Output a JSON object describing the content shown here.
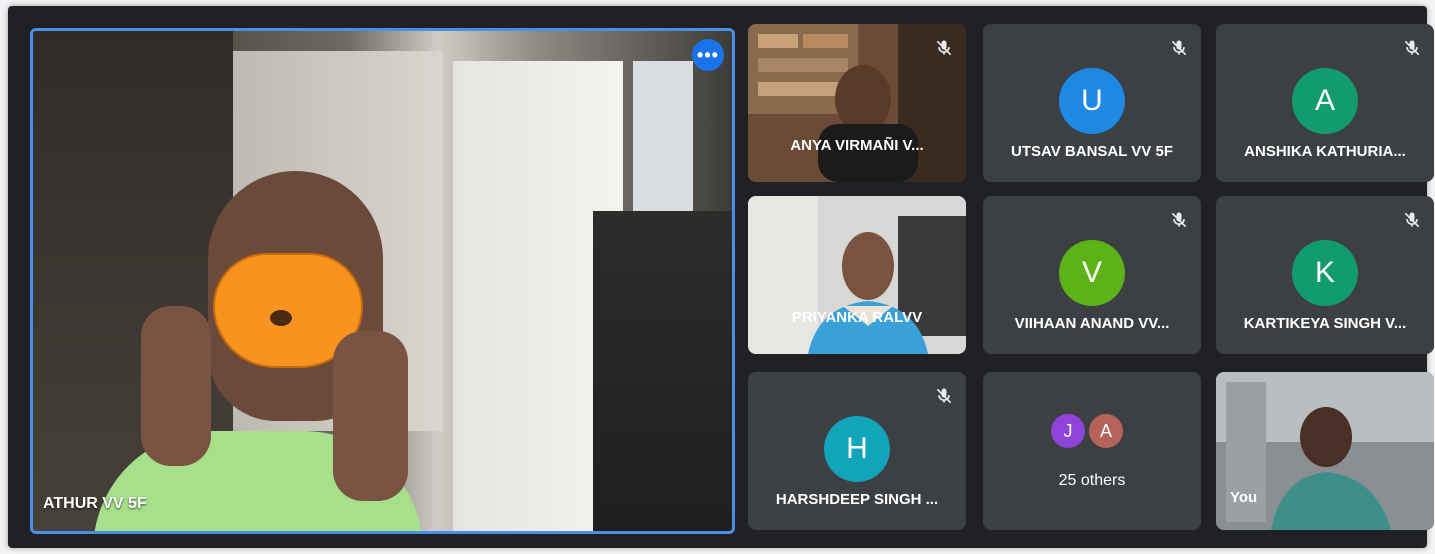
{
  "main": {
    "name": "ATHUR VV 5F",
    "more_label": "•••"
  },
  "tiles": [
    {
      "name": "ANYA VIRMAÑI V...",
      "type": "video",
      "muted": true
    },
    {
      "name": "UTSAV BANSAL VV 5F",
      "type": "avatar",
      "initial": "U",
      "color": "#1e88e5",
      "muted": true
    },
    {
      "name": "ANSHIKA KATHURIA...",
      "type": "avatar",
      "initial": "A",
      "color": "#129c6e",
      "muted": true
    },
    {
      "name": "PRIYANKA RALVV",
      "type": "video",
      "muted": false
    },
    {
      "name": "VIIHAAN ANAND VV...",
      "type": "avatar",
      "initial": "V",
      "color": "#5bb318",
      "muted": true
    },
    {
      "name": "KARTIKEYA SINGH V...",
      "type": "avatar",
      "initial": "K",
      "color": "#129c6e",
      "muted": true
    },
    {
      "name": "HARSHDEEP SINGH ...",
      "type": "avatar",
      "initial": "H",
      "color": "#12a4b8",
      "muted": true
    },
    {
      "name": "25 others",
      "type": "others",
      "avatars": [
        {
          "initial": "J",
          "color": "#8e44d8"
        },
        {
          "initial": "A",
          "color": "#b5635a"
        }
      ],
      "muted": false
    },
    {
      "name": "You",
      "type": "video",
      "muted": false
    }
  ]
}
